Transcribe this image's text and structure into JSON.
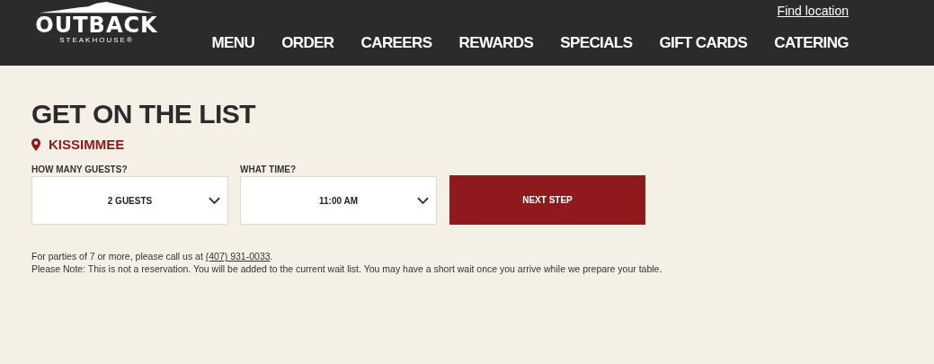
{
  "header": {
    "logo": {
      "name": "OUTBACK",
      "tagline": "STEAKHOUSE®"
    },
    "utility_link": "Find location",
    "nav": [
      {
        "label": "MENU"
      },
      {
        "label": "ORDER"
      },
      {
        "label": "CAREERS"
      },
      {
        "label": "REWARDS"
      },
      {
        "label": "SPECIALS"
      },
      {
        "label": "GIFT CARDS"
      },
      {
        "label": "CATERING"
      }
    ]
  },
  "title": "GET ON THE LIST",
  "location": "KISSIMMEE",
  "form": {
    "fields": [
      {
        "label": "HOW MANY GUESTS?",
        "value": "2 GUESTS"
      },
      {
        "label": "WHAT TIME?",
        "value": "11:00 AM"
      }
    ],
    "submit": "NEXT STEP"
  },
  "notes": {
    "call_prefix": "For parties of 7 or more, please call us at ",
    "phone": "(407) 931-0033",
    "call_suffix": ".",
    "disclaimer": "Please Note: This is not a reservation. You will be added to the current wait list. You may have a short wait once you arrive while we prepare your table."
  }
}
